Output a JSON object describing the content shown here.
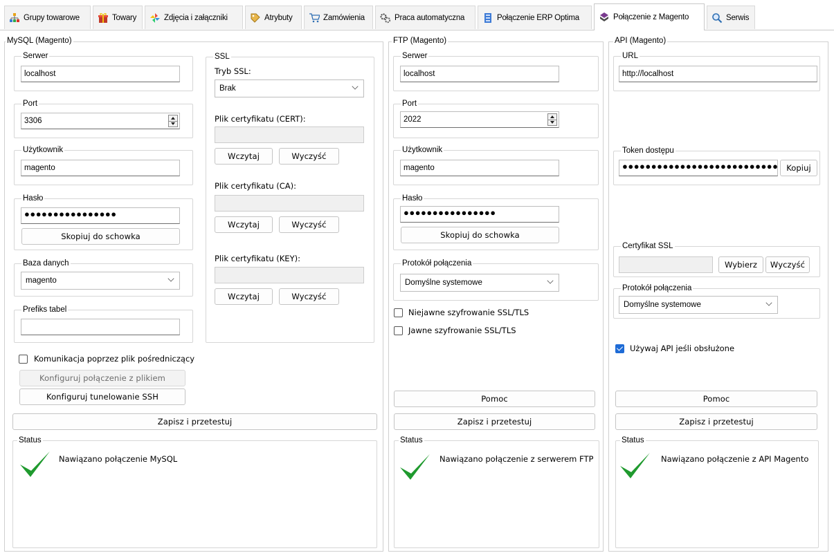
{
  "tabs": [
    {
      "label": "Grupy towarowe",
      "icon": "hierarchy-icon"
    },
    {
      "label": "Towary",
      "icon": "gift-box-icon"
    },
    {
      "label": "Zdjęcia i załączniki",
      "icon": "pinwheel-icon"
    },
    {
      "label": "Atrybuty",
      "icon": "tag-icon"
    },
    {
      "label": "Zamówienia",
      "icon": "cart-icon"
    },
    {
      "label": "Praca automatyczna",
      "icon": "gears-icon"
    },
    {
      "label": "Połączenie ERP Optima",
      "icon": "database-icon"
    },
    {
      "label": "Połączenie z Magento",
      "icon": "magento-icon"
    },
    {
      "label": "Serwis",
      "icon": "magnifier-icon"
    }
  ],
  "active_tab": "Połączenie z Magento",
  "mysql": {
    "title": "MySQL (Magento)",
    "server": {
      "label": "Serwer",
      "value": "localhost"
    },
    "port": {
      "label": "Port",
      "value": "3306"
    },
    "user": {
      "label": "Użytkownik",
      "value": "magento"
    },
    "password": {
      "label": "Hasło",
      "value": "●●●●●●●●●●●●●●●●",
      "copy_label": "Skopiuj do schowka"
    },
    "database": {
      "label": "Baza danych",
      "value": "magento"
    },
    "prefix": {
      "label": "Prefiks tabel",
      "value": ""
    },
    "ssl": {
      "title": "SSL",
      "mode_label": "Tryb SSL:",
      "mode_value": "Brak",
      "cert_label": "Plik certyfikatu (CERT):",
      "ca_label": "Plik certyfikatu (CA):",
      "key_label": "Plik certyfikatu (KEY):",
      "load_label": "Wczytaj",
      "clear_label": "Wyczyść"
    },
    "file_comm_label": "Komunikacja poprzez plik pośredniczący",
    "file_comm_checked": false,
    "configure_file_label": "Konfiguruj połączenie z plikiem",
    "configure_ssh_label": "Konfiguruj tunelowanie SSH",
    "save_label": "Zapisz i przetestuj",
    "status_label": "Status",
    "status_text": "Nawiązano połączenie MySQL"
  },
  "ftp": {
    "title": "FTP (Magento)",
    "server": {
      "label": "Serwer",
      "value": "localhost"
    },
    "port": {
      "label": "Port",
      "value": "2022"
    },
    "user": {
      "label": "Użytkownik",
      "value": "magento"
    },
    "password": {
      "label": "Hasło",
      "value": "●●●●●●●●●●●●●●●●",
      "copy_label": "Skopiuj do schowka"
    },
    "protocol": {
      "label": "Protokół połączenia",
      "value": "Domyślne systemowe"
    },
    "implicit_ssl_label": "Niejawne szyfrowanie SSL/TLS",
    "implicit_ssl_checked": false,
    "explicit_ssl_label": "Jawne szyfrowanie SSL/TLS",
    "explicit_ssl_checked": false,
    "help_label": "Pomoc",
    "save_label": "Zapisz i przetestuj",
    "status_label": "Status",
    "status_text": "Nawiązano połączenie z serwerem FTP"
  },
  "api": {
    "title": "API (Magento)",
    "url": {
      "label": "URL",
      "value": "http://localhost"
    },
    "token": {
      "label": "Token dostępu",
      "value": "●●●●●●●●●●●●●●●●●●●●●●●●●●●",
      "copy_label": "Kopiuj"
    },
    "cert": {
      "label": "Certyfikat SSL",
      "value": "",
      "choose_label": "Wybierz",
      "clear_label": "Wyczyść"
    },
    "protocol": {
      "label": "Protokół połączenia",
      "value": "Domyślne systemowe"
    },
    "use_api_label": "Używaj API jeśli obsłużone",
    "use_api_checked": true,
    "help_label": "Pomoc",
    "save_label": "Zapisz i przetestuj",
    "status_label": "Status",
    "status_text": "Nawiązano połączenie z API Magento"
  },
  "colors": {
    "checkmark": "#1f9a2e",
    "accent": "#1e6bd6"
  }
}
